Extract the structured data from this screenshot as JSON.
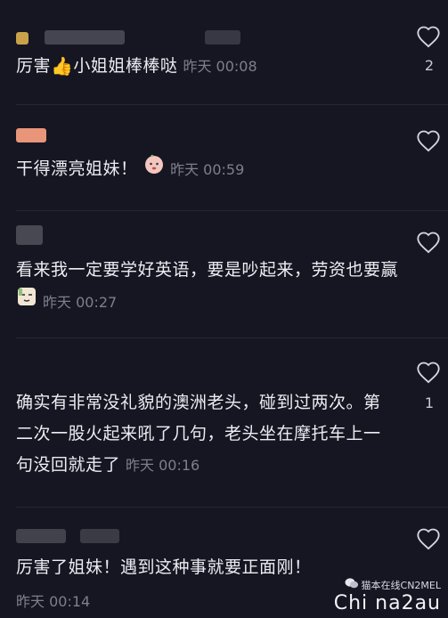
{
  "colors": {
    "background": "#161622",
    "text": "#ececf2",
    "timestamp": "#7f7f8c"
  },
  "comments": [
    {
      "text_before": "厉害",
      "emoji": "thumbs-up-icon",
      "text_after": "小姐姐棒棒哒",
      "time": "昨天 00:08",
      "likes": "2"
    },
    {
      "text": "干得漂亮姐妹！",
      "emoji": "peach-face-icon",
      "time": "昨天 00:59",
      "likes": ""
    },
    {
      "text": "看来我一定要学好英语，要是吵起来，劳资也要赢",
      "emoji": "sly-face-icon",
      "time": "昨天 00:27",
      "likes": ""
    },
    {
      "text": "确实有非常没礼貌的澳洲老头，碰到过两次。第二次一股火起来吼了几句，老头坐在摩托车上一句没回就走了",
      "time": "昨天 00:16",
      "likes": "1"
    },
    {
      "text": "厉害了姐妹！遇到这种事就要正面刚！",
      "time": "昨天 00:14",
      "likes": ""
    }
  ],
  "watermark": {
    "top": "猫本在线CN2MEL",
    "bottom": "Chi na2au",
    "icon": "wechat-icon"
  }
}
